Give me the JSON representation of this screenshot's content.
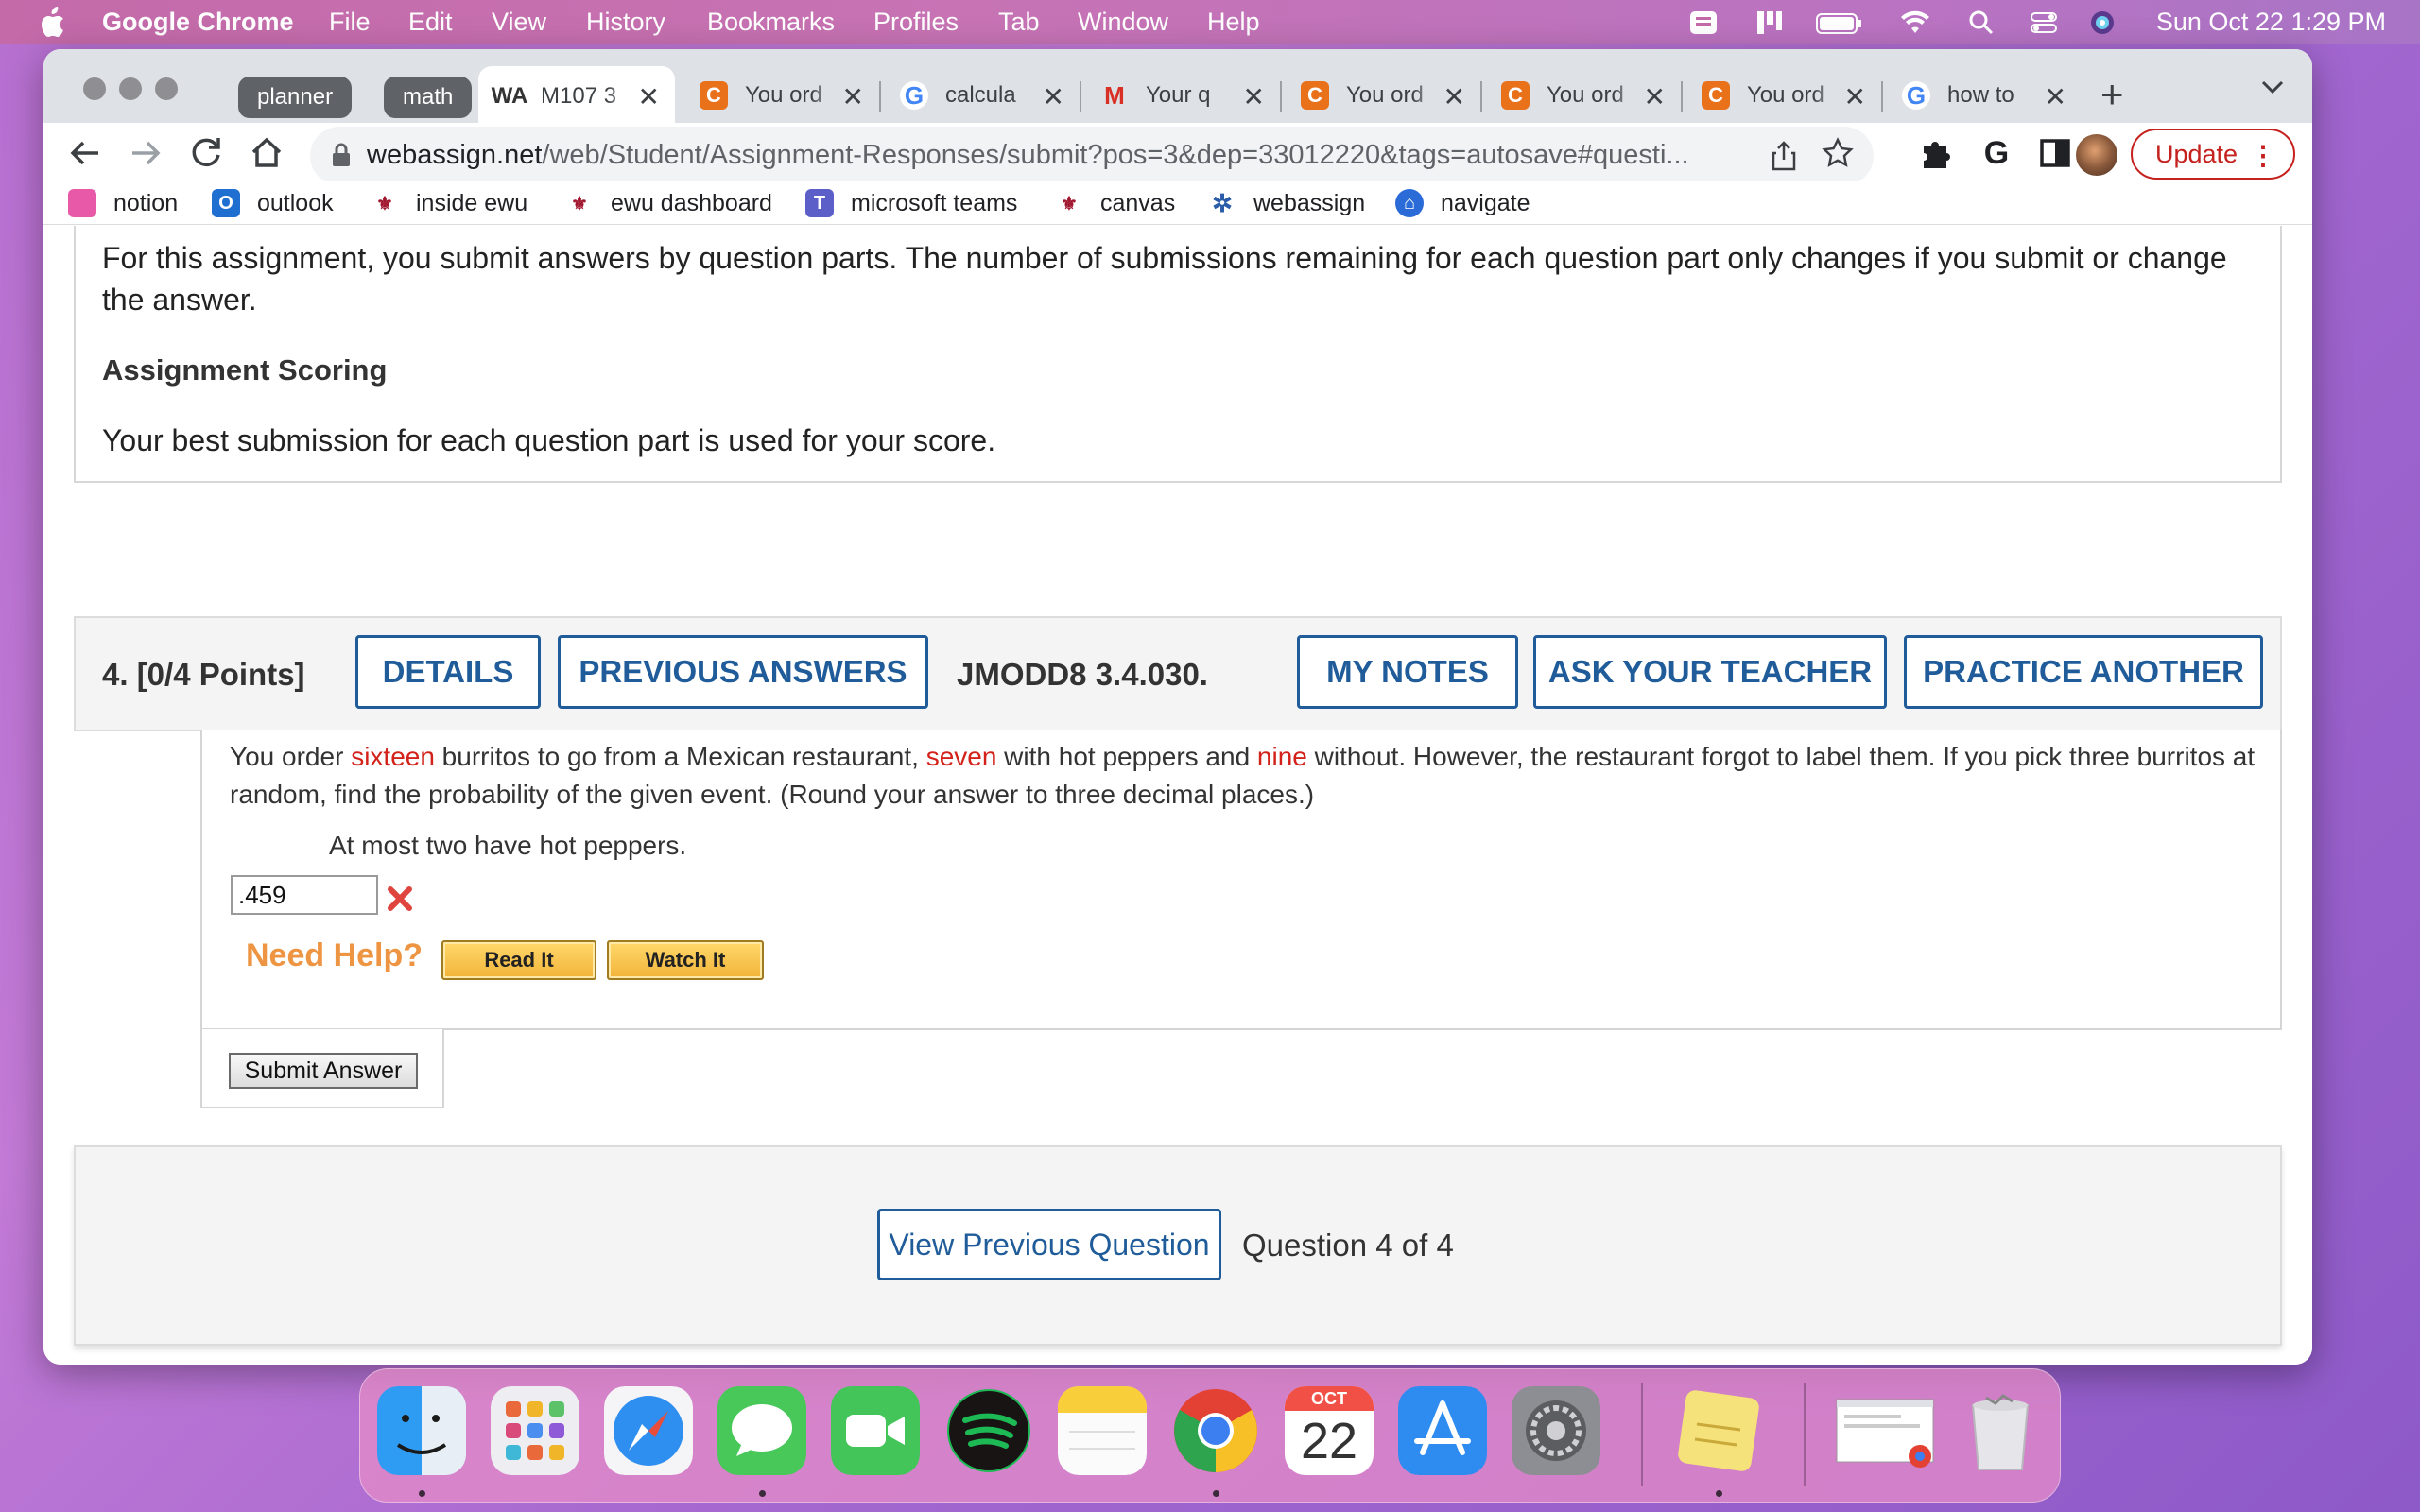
{
  "menubar": {
    "app_name": "Google Chrome",
    "items": [
      "File",
      "Edit",
      "View",
      "History",
      "Bookmarks",
      "Profiles",
      "Tab",
      "Window",
      "Help"
    ],
    "clock": "Sun Oct 22  1:29 PM"
  },
  "tabs": {
    "groups": [
      "planner",
      "math"
    ],
    "items": [
      {
        "title": "M107 3",
        "icon": "webassign-icon"
      },
      {
        "title": "You ord",
        "icon": "chegg-icon"
      },
      {
        "title": "calcula",
        "icon": "google-icon"
      },
      {
        "title": "Your q",
        "icon": "gmail-icon"
      },
      {
        "title": "You ord",
        "icon": "chegg-icon"
      },
      {
        "title": "You ord",
        "icon": "chegg-icon"
      },
      {
        "title": "You ord",
        "icon": "chegg-icon"
      },
      {
        "title": "how to",
        "icon": "google-icon"
      }
    ],
    "close_glyph": "✕",
    "new_tab_glyph": "+"
  },
  "toolbar": {
    "url_host": "webassign.net",
    "url_path": "/web/Student/Assignment-Responses/submit?pos=3&dep=33012220&tags=autosave#questi...",
    "update_label": "Update"
  },
  "bookmarks": [
    {
      "label": "notion",
      "color": "#e85aa8"
    },
    {
      "label": "outlook",
      "color": "#1f6fd1"
    },
    {
      "label": "inside ewu",
      "color": "#a1172f"
    },
    {
      "label": "ewu dashboard",
      "color": "#a1172f"
    },
    {
      "label": "microsoft teams",
      "color": "#5b5fc7"
    },
    {
      "label": "canvas",
      "color": "#a1172f"
    },
    {
      "label": "webassign",
      "color": "#2b5ca8"
    },
    {
      "label": "navigate",
      "color": "#2a6bd8"
    }
  ],
  "assignment": {
    "info_text": "For this assignment, you submit answers by question parts. The number of submissions remaining for each question part only changes if you submit or change the answer.",
    "scoring_heading": "Assignment Scoring",
    "scoring_text": "Your best submission for each question part is used for your score."
  },
  "question": {
    "number": "4.  [0/4 Points]",
    "buttons": {
      "details": "DETAILS",
      "previous_answers": "PREVIOUS ANSWERS",
      "my_notes": "MY NOTES",
      "ask_teacher": "ASK YOUR TEACHER",
      "practice_another": "PRACTICE ANOTHER"
    },
    "code": "JMODD8 3.4.030.",
    "text_parts": {
      "p1": "You order ",
      "n1": "sixteen",
      "p2": " burritos to go from a Mexican restaurant, ",
      "n2": "seven",
      "p3": " with hot peppers and ",
      "n3": "nine",
      "p4": " without. However, the restaurant forgot to label them. If you pick three burritos at random, find the probability of the given event. (Round your answer to three decimal places.)"
    },
    "event": "At most two have hot peppers.",
    "answer_value": ".459",
    "need_help": "Need Help?",
    "read_it": "Read It",
    "watch_it": "Watch It",
    "submit": "Submit Answer"
  },
  "navigation": {
    "prev_button": "View Previous Question",
    "counter": "Question 4 of 4"
  },
  "dock": {
    "calendar_month": "OCT",
    "calendar_day": "22"
  }
}
